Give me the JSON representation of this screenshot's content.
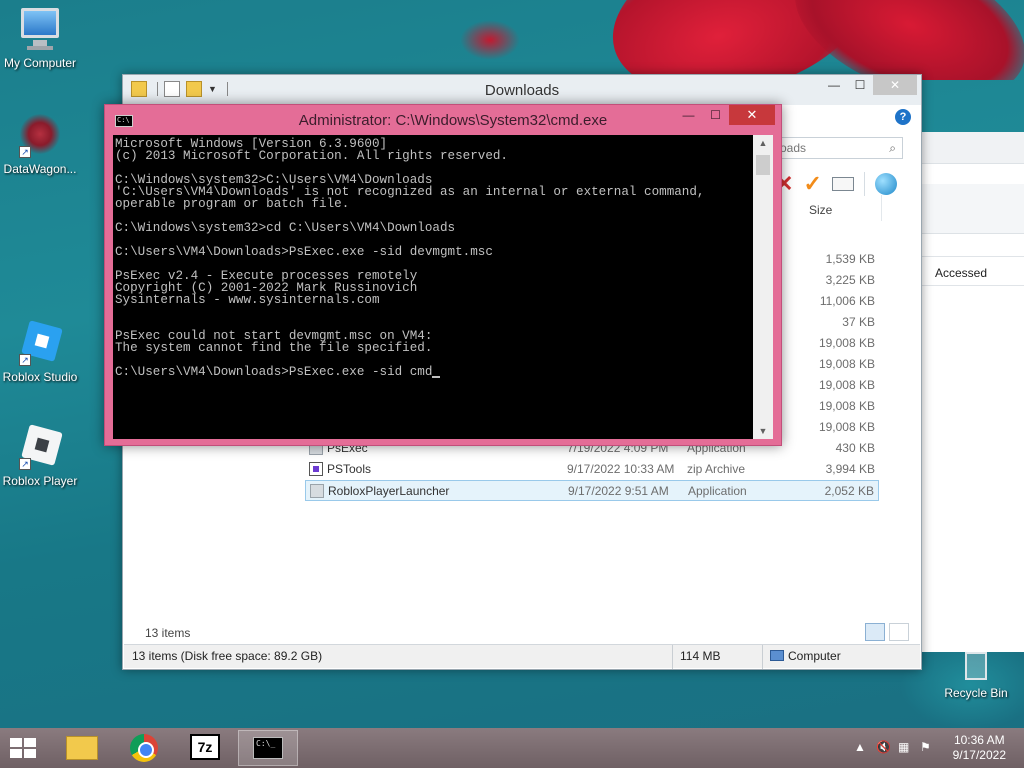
{
  "desktop": {
    "icons": [
      {
        "label": "My Computer",
        "icon": "my-computer-icon"
      },
      {
        "label": "DataWagon...",
        "icon": "datawagon-icon"
      },
      {
        "label": "Roblox Studio",
        "icon": "roblox-studio-icon"
      },
      {
        "label": "Roblox Player",
        "icon": "roblox-player-icon"
      },
      {
        "label": "Recycle Bin",
        "icon": "recycle-bin-icon"
      }
    ]
  },
  "explorer": {
    "title": "Downloads",
    "search_placeholder": "oads",
    "column_size": "Size",
    "sizes_above": [
      "1,539 KB",
      "3,225 KB",
      "11,006 KB",
      "37 KB",
      "19,008 KB",
      "19,008 KB",
      "19,008 KB",
      "19,008 KB",
      "19,008 KB"
    ],
    "files": [
      {
        "name": "PsExec",
        "date": "7/19/2022 4:09 PM",
        "type": "Application",
        "size": "430 KB",
        "icon": "application-icon"
      },
      {
        "name": "PSTools",
        "date": "9/17/2022 10:33 AM",
        "type": "zip Archive",
        "size": "3,994 KB",
        "icon": "zip-archive-icon"
      },
      {
        "name": "RobloxPlayerLauncher",
        "date": "9/17/2022 9:51 AM",
        "type": "Application",
        "size": "2,052 KB",
        "icon": "application-icon",
        "selected": true
      }
    ],
    "item_count": "13 items",
    "status": {
      "items": "13 items (Disk free space: 89.2 GB)",
      "size": "114 MB",
      "location": "Computer"
    },
    "window_buttons": {
      "minimize": "—",
      "maximize": "☐",
      "close": "✕"
    },
    "help": "?"
  },
  "background_window": {
    "column": "Accessed"
  },
  "cmd": {
    "title": "Administrator: C:\\Windows\\System32\\cmd.exe",
    "icon_text": "C:\\",
    "lines": [
      "Microsoft Windows [Version 6.3.9600]",
      "(c) 2013 Microsoft Corporation. All rights reserved.",
      "",
      "C:\\Windows\\system32>C:\\Users\\VM4\\Downloads",
      "'C:\\Users\\VM4\\Downloads' is not recognized as an internal or external command,",
      "operable program or batch file.",
      "",
      "C:\\Windows\\system32>cd C:\\Users\\VM4\\Downloads",
      "",
      "C:\\Users\\VM4\\Downloads>PsExec.exe -sid devmgmt.msc",
      "",
      "PsExec v2.4 - Execute processes remotely",
      "Copyright (C) 2001-2022 Mark Russinovich",
      "Sysinternals - www.sysinternals.com",
      "",
      "",
      "PsExec could not start devmgmt.msc on VM4:",
      "The system cannot find the file specified.",
      "",
      "C:\\Users\\VM4\\Downloads>PsExec.exe -sid cmd"
    ],
    "window_buttons": {
      "minimize": "—",
      "maximize": "☐",
      "close": "✕"
    }
  },
  "taskbar": {
    "apps": [
      {
        "name": "File Explorer",
        "icon": "file-explorer-icon"
      },
      {
        "name": "Google Chrome",
        "icon": "chrome-icon"
      },
      {
        "name": "7-Zip",
        "icon": "7zip-icon",
        "text": "7z"
      },
      {
        "name": "Command Prompt",
        "icon": "cmd-icon",
        "active": true
      }
    ],
    "clock": {
      "time": "10:36 AM",
      "date": "9/17/2022"
    }
  }
}
